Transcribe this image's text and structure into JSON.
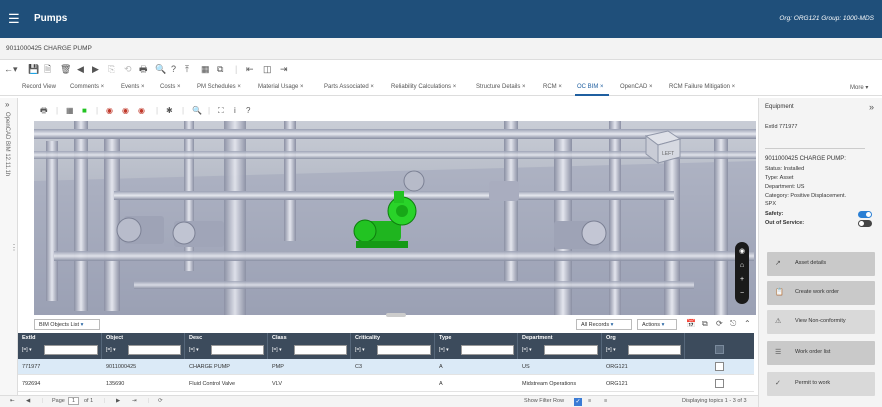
{
  "header": {
    "app_title": "Pumps",
    "org_info": "Org: ORG121 Group: 1000-MDS"
  },
  "record": {
    "title": "9011000425  CHARGE PUMP"
  },
  "tabs": [
    {
      "label": "Record View"
    },
    {
      "label": "Comments ×"
    },
    {
      "label": "Events ×"
    },
    {
      "label": "Costs ×"
    },
    {
      "label": "PM Schedules ×"
    },
    {
      "label": "Material Usage ×"
    },
    {
      "label": "Parts Associated ×"
    },
    {
      "label": "Reliability Calculations ×"
    },
    {
      "label": "Structure Details ×"
    },
    {
      "label": "RCM ×"
    },
    {
      "label": "OC BIM ×"
    },
    {
      "label": "OpenCAD ×"
    },
    {
      "label": "RCM Failure Mitigation ×"
    },
    {
      "label": "More ▾"
    }
  ],
  "viewer": {
    "side_label": "OpenCAD BIM 12.11.1h",
    "cube_label": "LEFT"
  },
  "grid": {
    "list_select": "BIM Objects List",
    "records_select": "All Records",
    "actions_select": "Actions",
    "columns": [
      {
        "name": "ExtId",
        "op": "[=] ▾"
      },
      {
        "name": "Object",
        "op": "[=] ▾"
      },
      {
        "name": "Desc",
        "op": "[=] ▾"
      },
      {
        "name": "Class",
        "op": "[=] ▾"
      },
      {
        "name": "Criticality",
        "op": "[=] ▾"
      },
      {
        "name": "Type",
        "op": "[=] ▾"
      },
      {
        "name": "Department",
        "op": "[=] ▾"
      },
      {
        "name": "Org",
        "op": "[=] ▾"
      }
    ],
    "rows": [
      {
        "extid": "771977",
        "object": "9011000425",
        "desc": "CHARGE PUMP",
        "class": "PMP",
        "criticality": "C3",
        "type": "A",
        "department": "US",
        "org": "ORG121",
        "selected": true
      },
      {
        "extid": "792694",
        "object": "135690",
        "desc": "Fluid Control Valve",
        "class": "VLV",
        "criticality": "",
        "type": "A",
        "department": "Midstream Operations",
        "org": "ORG121",
        "selected": false
      }
    ],
    "footer": {
      "page_label": "Page",
      "page_value": "1",
      "of_label": "of 1",
      "show_filter": "Show Filter Row",
      "displaying": "Displaying topics 1 - 3 of 3"
    }
  },
  "equipment_panel": {
    "title": "Equipment",
    "extid": "ExtId 771977",
    "name": "9011000425 CHARGE PUMP:",
    "status": "Status: Installed",
    "type": "Type: Asset",
    "department": "Department: US",
    "category": "Category: Positive Displacement.",
    "category2": "SPX",
    "safety_label": "Safety:",
    "out_of_service_label": "Out of Service:",
    "actions": [
      {
        "label": "Asset details",
        "icon": "external-link-icon"
      },
      {
        "label": "Create work order",
        "icon": "clipboard-icon"
      },
      {
        "label": "View Non-conformity",
        "icon": "warning-icon"
      },
      {
        "label": "Work order list",
        "icon": "list-icon"
      },
      {
        "label": "Permit to work",
        "icon": "permit-icon"
      }
    ]
  },
  "colors": {
    "header_bg": "#1f4f7a",
    "accent": "#1f5fa0",
    "grid_header_bg": "#3c4b5c",
    "highlight_object": "#22c322",
    "selected_row": "#dbeaf7"
  }
}
